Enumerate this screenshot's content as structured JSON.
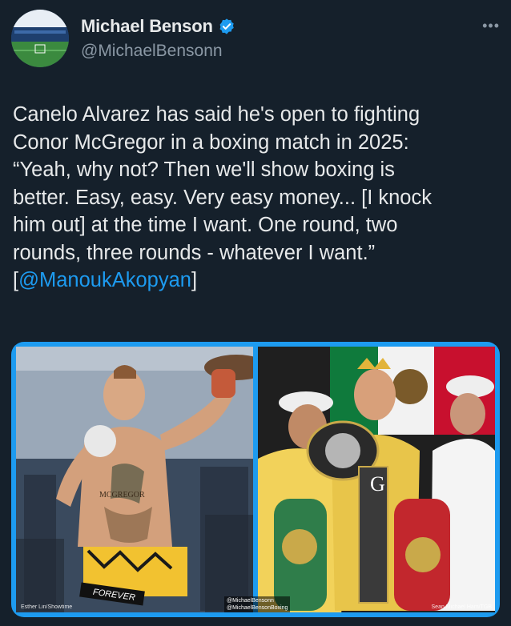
{
  "author": {
    "display_name": "Michael Benson",
    "handle": "@MichaelBensonn",
    "verified": true,
    "verified_color": "#1d9bf0",
    "avatar_icon": "stadium-avatar"
  },
  "more_label": "•••",
  "tweet": {
    "text_before": "Canelo Alvarez has said he's open to fighting\nConor McGregor in a boxing match in 2025:\n“Yeah, why not? Then we'll show boxing is\nbetter. Easy, easy. Very easy money... [I knock\nhim out] at the time I want. One round, two\nrounds, three rounds - whatever I want.”\n[",
    "mention": "@ManoukAkopyan",
    "text_after": "]"
  },
  "media": {
    "left_image_credit": "Esther Lin/Showtime",
    "right_image_credit": "Sean Michael Ham/TGB",
    "watermark_line1": "@MichaelBensonn",
    "watermark_line2": "@MichaelBensonBoxing",
    "left_trunks_text": "FOREVER",
    "left_tattoo_text": "MCGREGOR",
    "right_belt_text": "G",
    "accent_color": "#1d9bf0"
  }
}
